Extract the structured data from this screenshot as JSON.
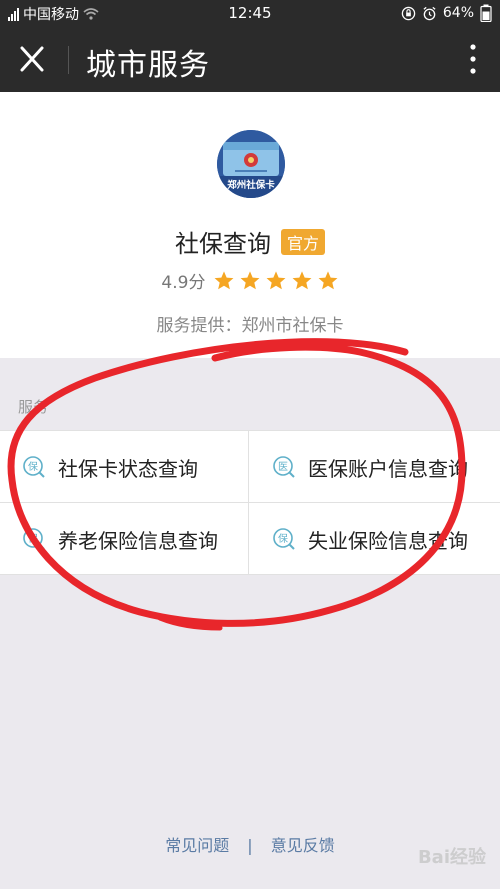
{
  "status_bar": {
    "carrier": "中国移动",
    "time": "12:45",
    "battery": "64%"
  },
  "nav": {
    "title": "城市服务"
  },
  "profile": {
    "avatar_text": "郑州社保卡",
    "name": "社保查询",
    "badge": "官方",
    "score": "4.9分",
    "stars": 5,
    "provider": "服务提供：郑州市社保卡"
  },
  "services": {
    "label": "服务",
    "items": [
      {
        "icon_char": "保",
        "label": "社保卡状态查询"
      },
      {
        "icon_char": "医",
        "label": "医保账户信息查询"
      },
      {
        "icon_char": "保",
        "label": "养老保险信息查询"
      },
      {
        "icon_char": "保",
        "label": "失业保险信息查询"
      }
    ]
  },
  "footer": {
    "faq": "常见问题",
    "separator": "|",
    "feedback": "意见反馈"
  },
  "watermark": "Bai经验",
  "colors": {
    "nav_bg": "#2b2b2b",
    "badge": "#f0a830",
    "star": "#f5a623",
    "icon": "#5fb0c9",
    "link": "#5a7ba4",
    "annotation": "#e8262b"
  }
}
